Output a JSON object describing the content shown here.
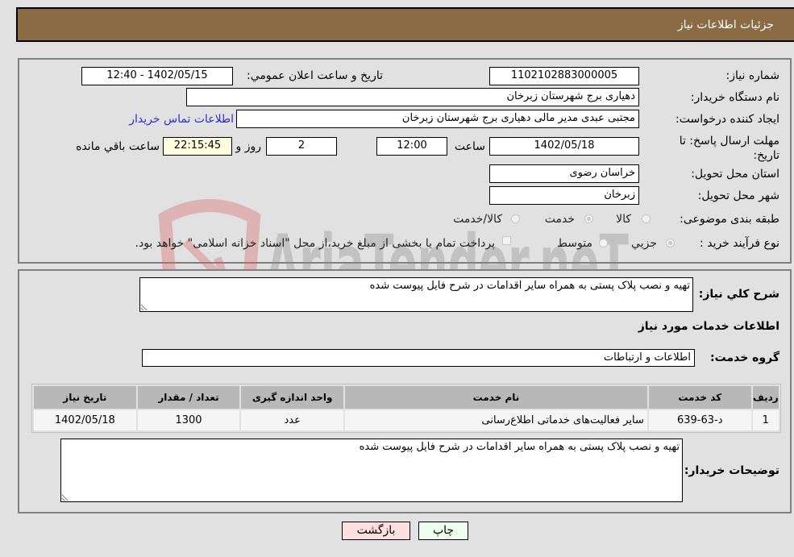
{
  "header": {
    "title": "جزئیات اطلاعات نیاز"
  },
  "fields": {
    "need_number": {
      "label": "شماره نیاز:",
      "value": "1102102883000005"
    },
    "announce_datetime": {
      "label": "تاریخ و ساعت اعلان عمومي:",
      "value": "1402/05/15 - 12:40"
    },
    "buyer_org": {
      "label": "نام دستگاه خريدار:",
      "value": "دهیاری برج شهرستان زبرخان"
    },
    "requester": {
      "label": "ایجاد کننده درخواست:",
      "value": "مجتبی عبدی مدیر مالی  دهیاری برج شهرستان زبرخان"
    },
    "buyer_contact_link": "اطلاعات تماس خريدار",
    "deadline": {
      "label": "مهلت ارسال پاسخ: تا تاریخ:",
      "date": "1402/05/18",
      "time_label": "ساعت",
      "time": "12:00",
      "days": "2",
      "days_label": "روز و",
      "remaining": "22:15:45",
      "remaining_label": "ساعت باقي مانده"
    },
    "province": {
      "label": "استان محل تحویل:",
      "value": "خراسان رضوی"
    },
    "city": {
      "label": "شهر محل تحویل:",
      "value": "زبرخان"
    },
    "category": {
      "label": "طبقه بندی موضوعی:",
      "options": [
        "کالا",
        "خدمت",
        "کالا/خدمت"
      ],
      "selected": "خدمت"
    },
    "purchase_type": {
      "label": "نوع فرآیند خرید :",
      "options": [
        "جزيي",
        "متوسط"
      ],
      "selected": "جزيي",
      "treasury_note": "پرداخت تمام یا بخشی از مبلغ خرید،از محل \"اسناد خزانه اسلامی\" خواهد بود.",
      "treasury_checked": false
    }
  },
  "summary": {
    "label": "شرح كلي نياز:",
    "value": "تهیه و نصب پلاک پستی به همراه سایر اقدامات در شرح فایل پیوست شده"
  },
  "services_section": {
    "title": "اطلاعات خدمات مورد نياز",
    "group_label": "گروه خدمت:",
    "group_value": "اطلاعات و ارتباطات"
  },
  "table": {
    "columns": [
      "رديف",
      "كد خدمت",
      "نام خدمت",
      "واحد اندازه گيری",
      "تعداد / مقدار",
      "تاريخ نياز"
    ],
    "rows": [
      [
        "1",
        "د-63-639",
        "سایر فعالیت‌های خدماتی اطلاع‌رسانی",
        "عدد",
        "1300",
        "1402/05/18"
      ]
    ]
  },
  "buyer_notes": {
    "label": "توضیحات خریدار:",
    "value": "تهیه و نصب پلاک پستی به همراه سایر اقدامات در شرح فایل پیوست شده"
  },
  "buttons": {
    "print": "چاپ",
    "back": "بازگشت"
  },
  "watermark": {
    "text": "AriaTender.neT"
  },
  "colors": {
    "header_bg": "#8b6b43",
    "print_bg": "#efffef",
    "back_bg": "#ffdfdf",
    "link": "#2d2dd4"
  }
}
